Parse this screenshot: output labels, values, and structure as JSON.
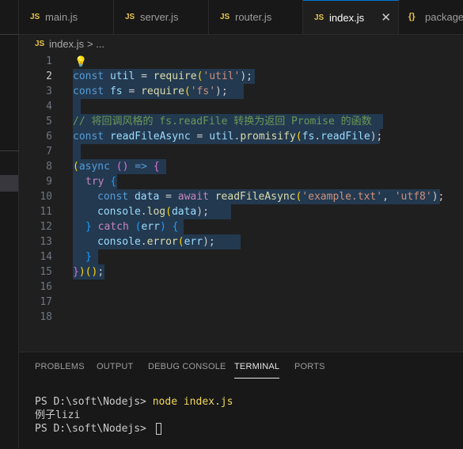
{
  "tabs": [
    {
      "icon": "JS",
      "label": "main.js",
      "active": false
    },
    {
      "icon": "JS",
      "label": "server.js",
      "active": false
    },
    {
      "icon": "JS",
      "label": "router.js",
      "active": false
    },
    {
      "icon": "JS",
      "label": "index.js",
      "active": true,
      "close": "✕"
    },
    {
      "icon": "{}",
      "label": "package",
      "active": false
    }
  ],
  "breadcrumb": {
    "icon": "JS",
    "file": "index.js",
    "sep": "> ..."
  },
  "editor": {
    "line_numbers": [
      "1",
      "2",
      "3",
      "4",
      "5",
      "6",
      "7",
      "8",
      "9",
      "10",
      "11",
      "12",
      "13",
      "14",
      "15",
      "16",
      "17",
      "18"
    ],
    "current_line": "2",
    "lightbulb": "💡"
  },
  "code_lines": {
    "l2": [
      "const",
      " ",
      "util",
      " = ",
      "require",
      "(",
      "'util'",
      ");"
    ],
    "l3": [
      "const",
      " ",
      "fs",
      " = ",
      "require",
      "(",
      "'fs'",
      ");"
    ],
    "l5": "// 将回调风格的 fs.readFile 转换为返回 Promise 的函数",
    "l6": [
      "const",
      " ",
      "readFileAsync",
      " = ",
      "util",
      ".",
      "promisify",
      "(",
      "fs",
      ".",
      "readFile",
      ");"
    ],
    "l8": [
      "(",
      "async",
      " ",
      "()",
      " => ",
      "{"
    ],
    "l9": [
      "try",
      " ",
      "{"
    ],
    "l10": [
      "const",
      " ",
      "data",
      " = ",
      "await",
      " ",
      "readFileAsync",
      "(",
      "'example.txt'",
      ", ",
      "'utf8'",
      ");"
    ],
    "l11": [
      "console",
      ".",
      "log",
      "(",
      "data",
      ");"
    ],
    "l12": [
      "}",
      " ",
      "catch",
      " ",
      "(",
      "err",
      ")",
      " ",
      "{"
    ],
    "l13": [
      "console",
      ".",
      "error",
      "(",
      "err",
      ");"
    ],
    "l14": [
      "}"
    ],
    "l15": [
      "}",
      ")",
      "()",
      ";"
    ]
  },
  "panel": {
    "tabs": [
      "PROBLEMS",
      "OUTPUT",
      "DEBUG CONSOLE",
      "TERMINAL",
      "PORTS"
    ],
    "active_tab": "TERMINAL",
    "terminal": {
      "prompt1": "PS D:\\soft\\Nodejs> ",
      "command1": "node index.js",
      "output1": "例子lizi",
      "prompt2": "PS D:\\soft\\Nodejs> "
    }
  }
}
